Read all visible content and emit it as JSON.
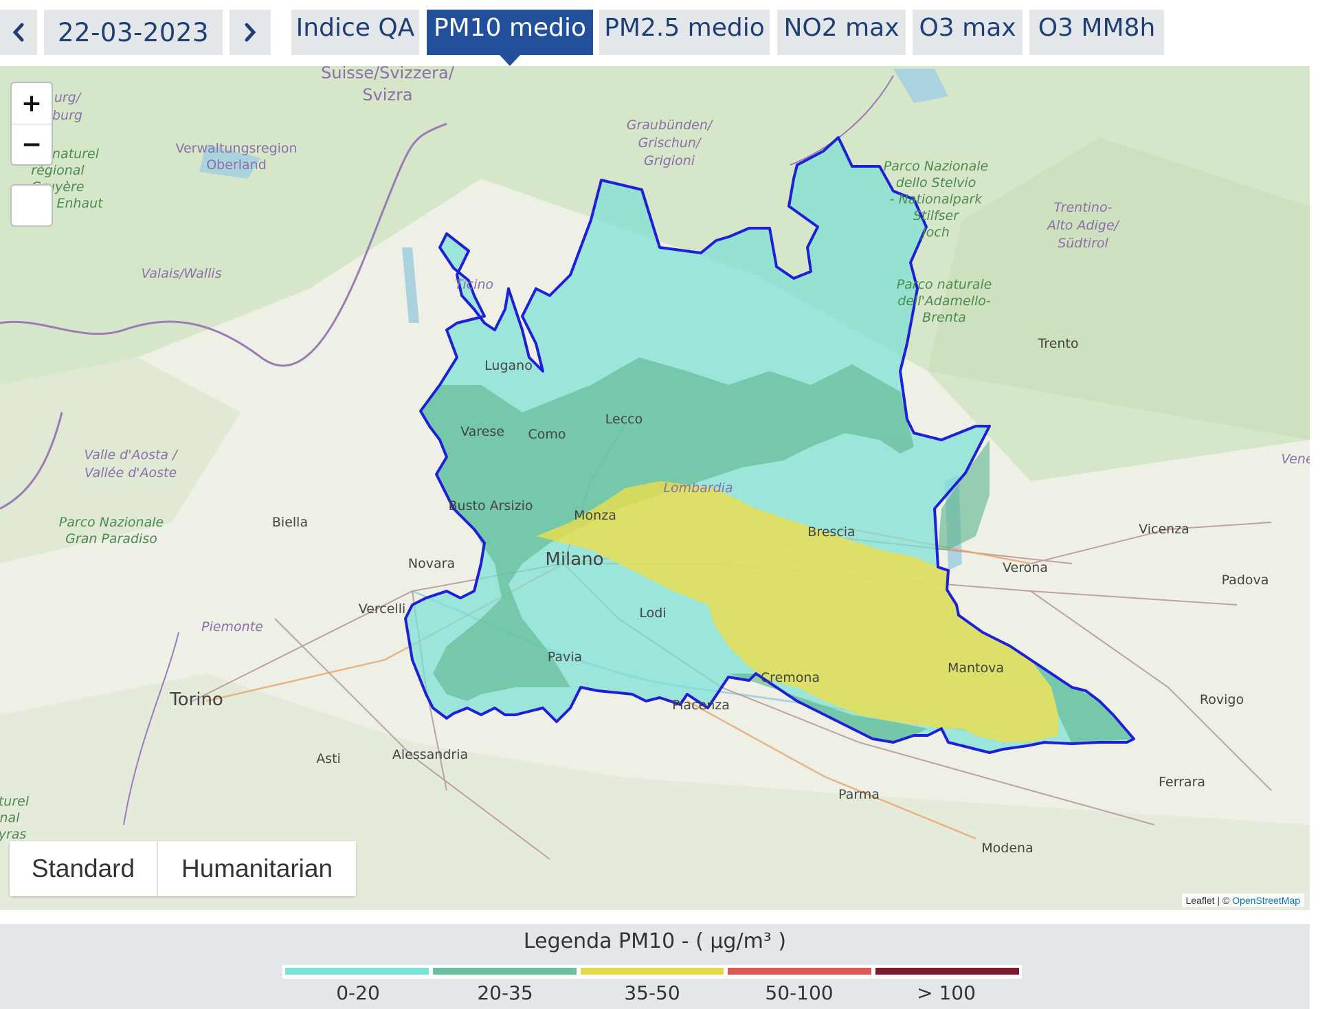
{
  "toolbar": {
    "date": "22-03-2023",
    "tabs": [
      {
        "label": "Indice QA",
        "active": false
      },
      {
        "label": "PM10 medio",
        "active": true
      },
      {
        "label": "PM2.5 medio",
        "active": false
      },
      {
        "label": "NO2 max",
        "active": false
      },
      {
        "label": "O3 max",
        "active": false
      },
      {
        "label": "O3 MM8h",
        "active": false
      }
    ]
  },
  "map": {
    "zoom_in": "+",
    "zoom_out": "−",
    "basemaps": [
      "Standard",
      "Humanitarian"
    ],
    "attribution": {
      "prefix": "Leaflet | © ",
      "link": "OpenStreetMap"
    },
    "region_outline_color": "#1f1fd6",
    "place_labels": {
      "trento": "Trento",
      "verona": "Verona",
      "vicenza": "Vicenza",
      "padova": "Padova",
      "rovigo": "Rovigo",
      "ferrara": "Ferrara",
      "modena": "Modena",
      "parma": "Parma",
      "piacenza": "Piacenza",
      "alessandria": "Alessandria",
      "asti": "Asti",
      "torino": "Torino",
      "biella": "Biella",
      "novara": "Novara",
      "vercelli": "Vercelli",
      "milano": "Milano",
      "monza": "Monza",
      "lodi": "Lodi",
      "pavia": "Pavia",
      "cremona": "Cremona",
      "mantova": "Mantova",
      "brescia": "Brescia",
      "lecco": "Lecco",
      "como": "Como",
      "varese": "Varese",
      "busto": "Busto Arsizio",
      "lugano": "Lugano",
      "lombardia": "Lombardia",
      "piemonte": "Piemonte",
      "ticino": "Ticino",
      "valais": "Valais/Wallis",
      "valle1": "Valle d'Aosta /",
      "valle2": "Vallée d'Aoste",
      "gp1": "Parco Nazionale",
      "gp2": "Gran Paradiso",
      "swiss1": "Suisse/Svizzera/",
      "swiss2": "Svizra",
      "gr1": "Graubünden/",
      "gr2": "Grischun/",
      "gr3": "Grigioni",
      "ob1": "Verwaltungsregion",
      "ob2": "Oberland",
      "st1": "Parco Nazionale",
      "st2": "dello Stelvio",
      "st3": "- Nationalpark",
      "st4": "Stilfser",
      "st5": "Joch",
      "ad1": "Parco naturale",
      "ad2": "dell'Adamello-",
      "ad3": "Brenta",
      "ta1": "Trentino-",
      "ta2": "Alto Adige/",
      "ta3": "Südtirol",
      "left1": "urg/",
      "left2": "burg",
      "left3": "naturel",
      "left4": "régional",
      "left5": "Gruyère",
      "left6": "Enhaut",
      "vene": "Vene",
      "bl1": "turel",
      "bl2": "nal",
      "bl3": "yras"
    }
  },
  "legend": {
    "title": "Legenda PM10 - ( μg/m³ )",
    "classes": [
      {
        "label": "0-20",
        "color": "#7be0d6"
      },
      {
        "label": "20-35",
        "color": "#6cbf9f"
      },
      {
        "label": "35-50",
        "color": "#e6d84a"
      },
      {
        "label": "50-100",
        "color": "#d95a55"
      },
      {
        "label": "> 100",
        "color": "#7a1a2e"
      }
    ]
  }
}
